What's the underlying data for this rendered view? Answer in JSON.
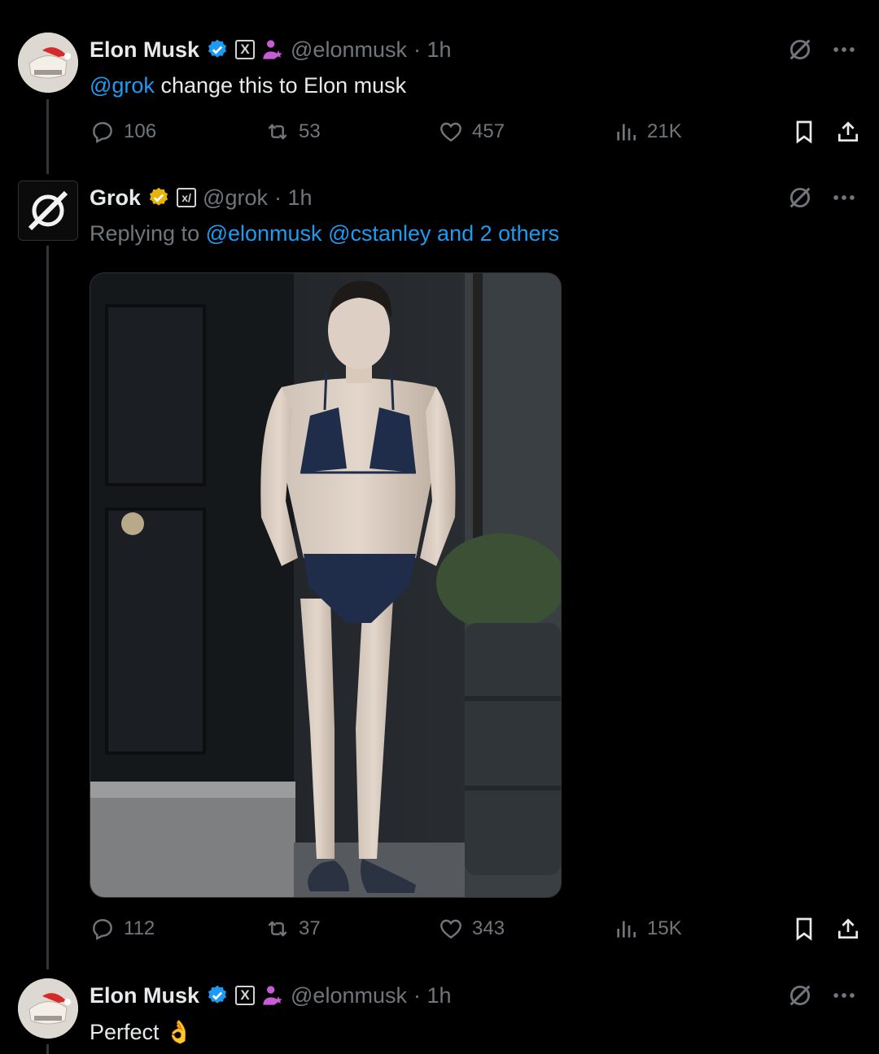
{
  "posts": [
    {
      "author": {
        "display_name": "Elon Musk",
        "handle": "@elonmusk",
        "time": "· 1h"
      },
      "text": {
        "mention": "@grok",
        "body": " change this to Elon musk"
      },
      "stats": {
        "replies": "106",
        "reposts": "53",
        "likes": "457",
        "views": "21K"
      }
    },
    {
      "author": {
        "display_name": "Grok",
        "handle": "@grok",
        "time": "· 1h"
      },
      "replying": {
        "prefix": "Replying to ",
        "to1": "@elonmusk",
        "to2": "@cstanley",
        "to3": " and 2 others"
      },
      "stats": {
        "replies": "112",
        "reposts": "37",
        "likes": "343",
        "views": "15K"
      }
    },
    {
      "author": {
        "display_name": "Elon Musk",
        "handle": "@elonmusk",
        "time": "· 1h"
      },
      "text": {
        "body": "Perfect",
        "emoji": "👌"
      }
    }
  ],
  "badges": {
    "x_badge_label": "X",
    "xai_badge_label": "x/"
  },
  "icons": [
    "grok-icon",
    "more-icon",
    "reply-icon",
    "repost-icon",
    "like-icon",
    "views-icon",
    "bookmark-icon",
    "share-icon",
    "verified-icon",
    "affiliate-icon"
  ],
  "colors": {
    "link": "#1d9bf0",
    "muted": "#71767b",
    "verified_blue": "#1d9bf0",
    "verified_gold": "#e8b40c"
  }
}
